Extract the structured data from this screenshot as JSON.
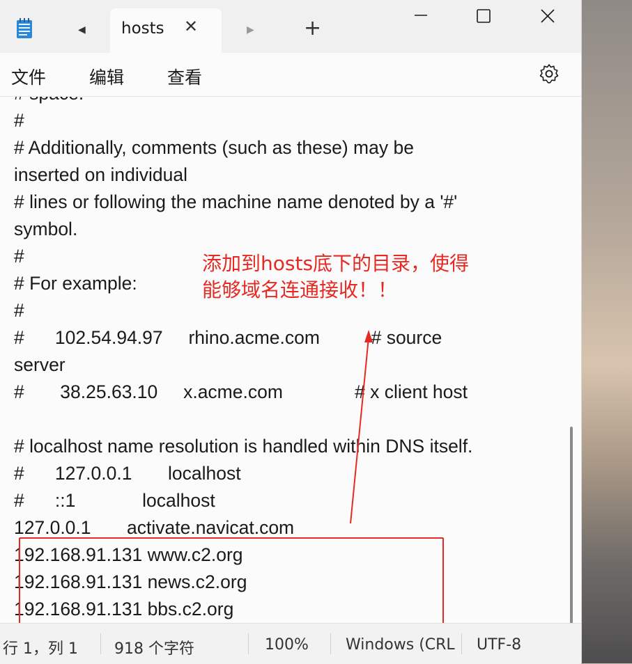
{
  "tab": {
    "title": "hosts"
  },
  "menu": {
    "file": "文件",
    "edit": "编辑",
    "view": "查看"
  },
  "editor": {
    "lines": [
      "# space.",
      "#",
      "# Additionally, comments (such as these) may be",
      "inserted on individual",
      "# lines or following the machine name denoted by a '#'",
      "symbol.",
      "#",
      "# For example:",
      "#",
      "#      102.54.94.97     rhino.acme.com          # source",
      "server",
      "#       38.25.63.10     x.acme.com              # x client host",
      "",
      "# localhost name resolution is handled within DNS itself.",
      "#      127.0.0.1       localhost",
      "#      ::1             localhost",
      "127.0.0.1       activate.navicat.com",
      "192.168.91.131 www.c2.org",
      "192.168.91.131 news.c2.org",
      "192.168.91.131 bbs.c2.org"
    ]
  },
  "annotation": {
    "line1": "添加到hosts底下的目录，使得",
    "line2": "能够域名连通接收！！",
    "color": "#e62a23"
  },
  "status": {
    "position": "行 1，列 1",
    "chars": "918 个字符",
    "zoom": "100%",
    "line_ending": "Windows (CRL",
    "encoding": "UTF-8"
  }
}
